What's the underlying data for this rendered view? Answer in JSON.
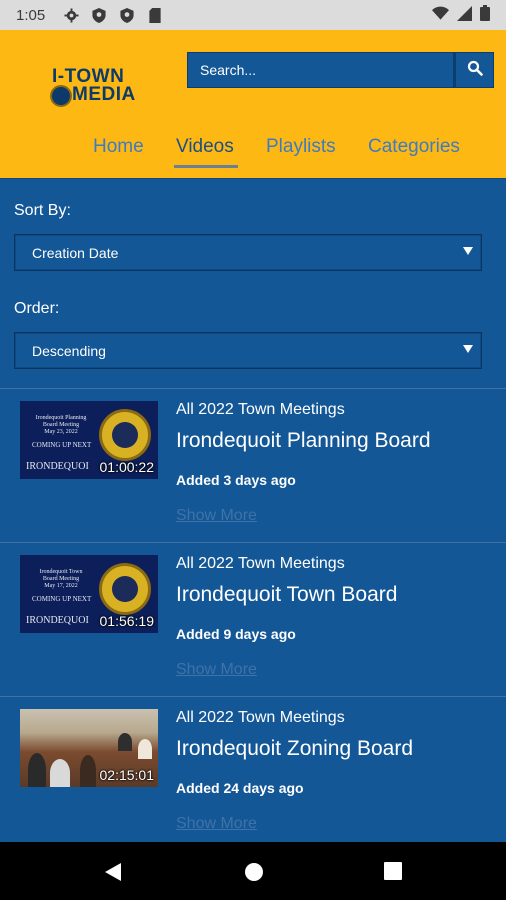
{
  "status_bar": {
    "time": "1:05",
    "icons": [
      "gear-icon",
      "shield-icon",
      "shield-icon",
      "sd-card-icon"
    ],
    "right_icons": [
      "wifi-icon",
      "signal-icon",
      "battery-icon"
    ]
  },
  "header": {
    "logo": {
      "line1": "I-TOWN",
      "line2": "MEDIA"
    },
    "search": {
      "placeholder": "Search...",
      "button_icon": "search-icon"
    },
    "tabs": [
      {
        "label": "Home",
        "active": false
      },
      {
        "label": "Videos",
        "active": true
      },
      {
        "label": "Playlists",
        "active": false
      },
      {
        "label": "Categories",
        "active": false
      }
    ]
  },
  "filters": {
    "sort_label": "Sort By:",
    "sort_value": "Creation Date",
    "order_label": "Order:",
    "order_value": "Descending"
  },
  "videos": [
    {
      "thumb_text": [
        "Irondequoit Planning",
        "Board Meeting",
        "May 23, 2022"
      ],
      "thumb_coming": "COMING UP NEXT",
      "thumb_brand": "IRONDEQUOI",
      "duration": "01:00:22",
      "category": "All 2022 Town Meetings",
      "title": "Irondequoit Planning Board",
      "added": "Added 3 days ago",
      "more": "Show More"
    },
    {
      "thumb_text": [
        "Irondequoit Town",
        "Board Meeting",
        "May 17, 2022"
      ],
      "thumb_coming": "COMING UP NEXT",
      "thumb_brand": "IRONDEQUOI",
      "duration": "01:56:19",
      "category": "All 2022 Town Meetings",
      "title": "Irondequoit Town Board",
      "added": "Added 9 days ago",
      "more": "Show More"
    },
    {
      "duration": "02:15:01",
      "category": "All 2022 Town Meetings",
      "title": "Irondequoit Zoning Board",
      "added": "Added 24 days ago",
      "more": "Show More"
    }
  ],
  "colors": {
    "header_bg": "#fdb813",
    "page_bg": "#135796",
    "tab_color": "#3f7bc1",
    "link_muted": "#3f72a7"
  }
}
